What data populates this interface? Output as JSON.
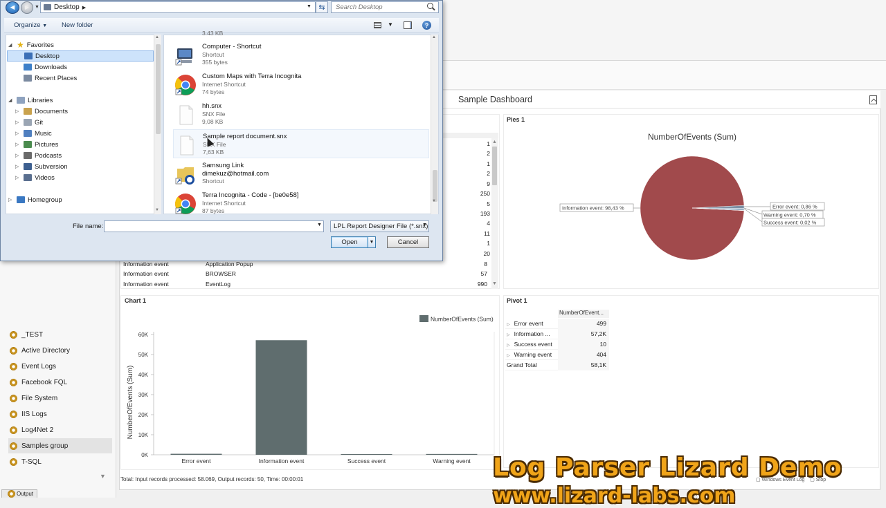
{
  "dialog": {
    "address": "Desktop",
    "search_placeholder": "Search Desktop",
    "organize": "Organize",
    "new_folder": "New folder",
    "nav_tree": {
      "favorites": "Favorites",
      "favorite_items": [
        "Desktop",
        "Downloads",
        "Recent Places"
      ],
      "libraries": "Libraries",
      "library_items": [
        "Documents",
        "Git",
        "Music",
        "Pictures",
        "Podcasts",
        "Subversion",
        "Videos"
      ],
      "homegroup": "Homegroup"
    },
    "top_partial_size": "3,43 KB",
    "files": [
      {
        "name": "Computer - Shortcut",
        "type": "Shortcut",
        "size": "355 bytes",
        "icon": "computer-icon"
      },
      {
        "name": "Custom Maps with Terra Incognita",
        "type": "Internet Shortcut",
        "size": "74 bytes",
        "icon": "chrome-icon"
      },
      {
        "name": "hh.snx",
        "type": "SNX File",
        "size": "9,08 KB",
        "icon": "document-icon"
      },
      {
        "name": "Sample report document.snx",
        "type": "SNX File",
        "size": "7,63 KB",
        "icon": "document-icon"
      },
      {
        "name": "Samsung Link",
        "extra": "dimekuz@hotmail.com",
        "type": "Shortcut",
        "icon": "folder-shortcut-icon"
      },
      {
        "name": "Terra Incognita - Code - [be0e58]",
        "type": "Internet Shortcut",
        "size": "87 bytes",
        "icon": "chrome-icon"
      }
    ],
    "file_name_label": "File name:",
    "file_name_value": "",
    "filter": "LPL Report Designer File (*.snx)",
    "open": "Open",
    "cancel": "Cancel"
  },
  "dashboard": {
    "title": "Sample Dashboard",
    "pies_title": "Pies 1",
    "pie_chart_title": "NumberOfEvents (Sum)",
    "pie_labels": {
      "information": "Information event: 98,43 %",
      "error": "Error event: 0,86 %",
      "warning": "Warning event: 0,70 %",
      "success": "Success event: 0,02 %"
    },
    "chart_title": "Chart 1",
    "pivot_title": "Pivot 1",
    "grid_counts": [
      "1",
      "2",
      "1",
      "2",
      "9",
      "250",
      "5",
      "193",
      "4",
      "11",
      "1",
      "20",
      "8",
      "57",
      "990"
    ],
    "grid_rows": [
      {
        "type": "Information event",
        "source": "Application Popup",
        "count": "8"
      },
      {
        "type": "Information event",
        "source": "BROWSER",
        "count": "57"
      },
      {
        "type": "Information event",
        "source": "EventLog",
        "count": "990"
      }
    ],
    "pivot": {
      "column_header": "NumberOfEvent...",
      "rows": [
        {
          "label": "Error event",
          "value": "499"
        },
        {
          "label": "Information ...",
          "value": "57,2K"
        },
        {
          "label": "Success event",
          "value": "10"
        },
        {
          "label": "Warning event",
          "value": "404"
        }
      ],
      "grand_total_label": "Grand Total",
      "grand_total_value": "58,1K"
    },
    "status": "Total: Input records processed: 58.069, Output records: 50, Time: 00:00:01"
  },
  "sidebar": {
    "items": [
      "_TEST",
      "Active Directory",
      "Event Logs",
      "Facebook FQL",
      "File System",
      "IIS Logs",
      "Log4Net 2",
      "Samples group",
      "T-SQL"
    ],
    "output_tab": "Output"
  },
  "watermark": {
    "line1": "Log Parser Lizard Demo",
    "line2": "www.lizard-labs.com"
  },
  "colors": {
    "pie_main": "#a14a4c",
    "bar": "#5f6d6e",
    "watermark": "#f0a419"
  },
  "chart_data": [
    {
      "type": "bar",
      "title": "",
      "categories": [
        "Error event",
        "Information event",
        "Success event",
        "Warning event"
      ],
      "series": [
        {
          "name": "NumberOfEvents (Sum)",
          "values": [
            499,
            57156,
            10,
            404
          ]
        }
      ],
      "ylabel": "NumberOfEvents (Sum)",
      "xlabel": "",
      "ylim": [
        0,
        60000
      ],
      "yticks": [
        "0K",
        "10K",
        "20K",
        "30K",
        "40K",
        "50K",
        "60K"
      ],
      "grid": false,
      "legend": "top-right"
    },
    {
      "type": "pie",
      "title": "NumberOfEvents (Sum)",
      "categories": [
        "Information event",
        "Error event",
        "Warning event",
        "Success event"
      ],
      "values": [
        98.43,
        0.86,
        0.7,
        0.02
      ]
    }
  ]
}
